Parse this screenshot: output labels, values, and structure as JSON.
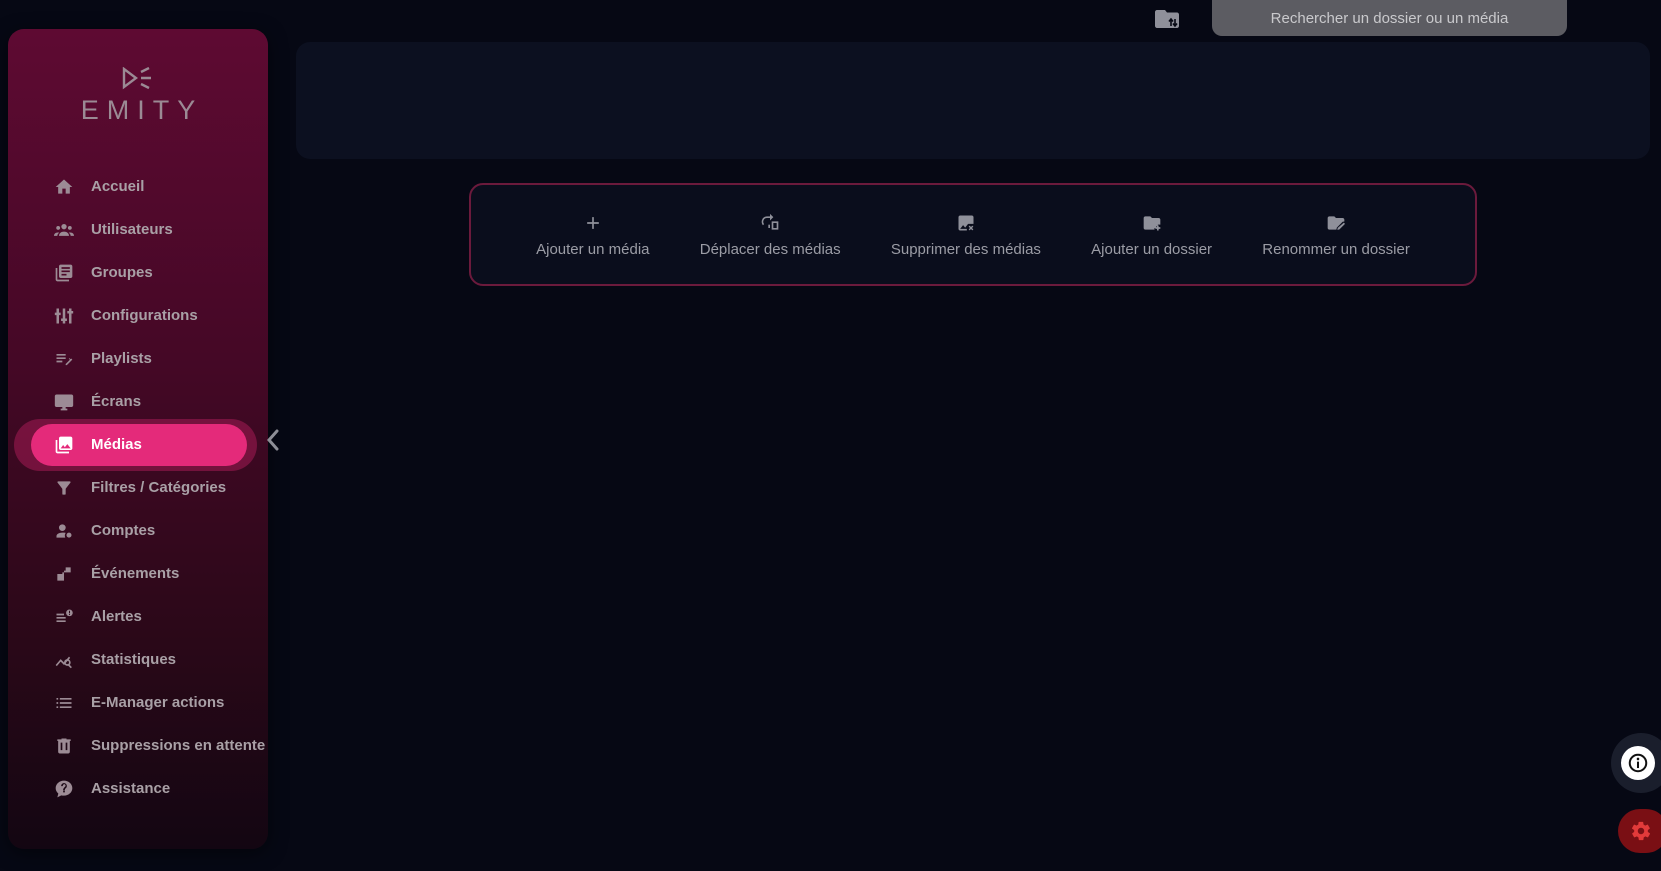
{
  "brand": {
    "name": "EMITY"
  },
  "topbar": {
    "search_placeholder": "Rechercher un dossier ou un média",
    "folder_icon": "folder-sort-icon"
  },
  "sidebar": {
    "active_index": 6,
    "items": [
      {
        "label": "Accueil",
        "icon": "home-icon"
      },
      {
        "label": "Utilisateurs",
        "icon": "users-icon"
      },
      {
        "label": "Groupes",
        "icon": "library-icon"
      },
      {
        "label": "Configurations",
        "icon": "sliders-icon"
      },
      {
        "label": "Playlists",
        "icon": "playlist-edit-icon"
      },
      {
        "label": "Écrans",
        "icon": "monitor-icon"
      },
      {
        "label": "Médias",
        "icon": "photo-library-icon"
      },
      {
        "label": "Filtres / Catégories",
        "icon": "filter-icon"
      },
      {
        "label": "Comptes",
        "icon": "account-icon"
      },
      {
        "label": "Événements",
        "icon": "events-icon"
      },
      {
        "label": "Alertes",
        "icon": "alert-list-icon"
      },
      {
        "label": "Statistiques",
        "icon": "stats-icon"
      },
      {
        "label": "E-Manager actions",
        "icon": "list-icon"
      },
      {
        "label": "Suppressions en attente",
        "icon": "trash-icon"
      },
      {
        "label": "Assistance",
        "icon": "chat-help-icon"
      }
    ]
  },
  "toolbar": {
    "actions": [
      {
        "label": "Ajouter un média",
        "icon": "plus-icon"
      },
      {
        "label": "Déplacer des médias",
        "icon": "move-media-icon"
      },
      {
        "label": "Supprimer des médias",
        "icon": "delete-image-icon"
      },
      {
        "label": "Ajouter un dossier",
        "icon": "folder-plus-icon"
      },
      {
        "label": "Renommer un dossier",
        "icon": "folder-edit-icon"
      }
    ]
  },
  "colors": {
    "accent": "#e42a7a",
    "background": "#060814",
    "panel": "#0c1020",
    "search_bg": "#5c5c62",
    "settings_red": "#7a0f14"
  }
}
